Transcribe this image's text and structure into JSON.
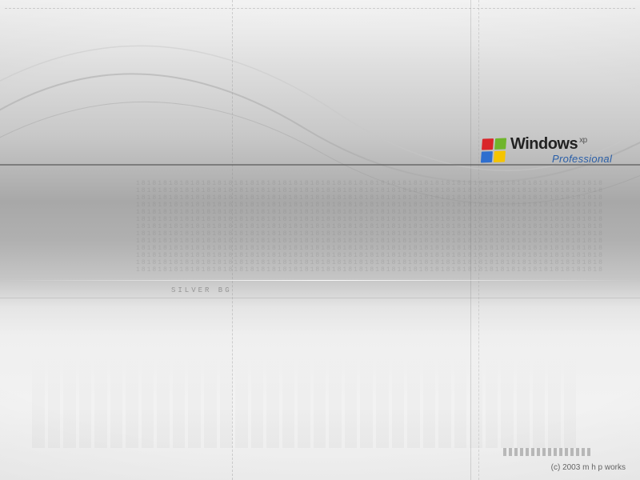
{
  "brand": {
    "name": "Windows",
    "suffix": "xp",
    "edition": "Professional"
  },
  "theme_label": "SILVER BG",
  "copyright": "(c) 2003 m h p works",
  "flag_colors": {
    "top_left": "#d9252a",
    "top_right": "#6fb52c",
    "bottom_left": "#2f6fcf",
    "bottom_right": "#f5c400"
  },
  "binary_pattern_sample": "18181818181818181818181818181818181818181818181818181818181818181818181818181818181818"
}
